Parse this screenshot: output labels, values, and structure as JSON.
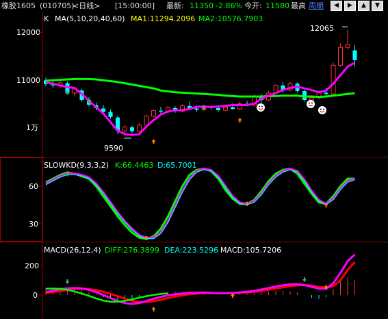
{
  "header": {
    "symbol": "橡胶1605",
    "code": "(010705)",
    "period": "<日线>",
    "time": "[15:00:00]",
    "latest_label": "最新:",
    "latest_value": "11350",
    "change_pct": "-2.86%",
    "open_label": "今开:",
    "open_value": "11580",
    "high_label": "最高",
    "cycle_label": "周期",
    "nav_icons": [
      "arrow-left-icon",
      "arrow-right-icon",
      "arrow-up-icon",
      "arrow-down-icon"
    ],
    "nav_glyphs": [
      "◀",
      "▶",
      "▲",
      "▼"
    ]
  },
  "colors": {
    "up": "#ff3232",
    "down": "#00ffff",
    "ma1": "#ff00ff",
    "ma2": "#00ff00",
    "grid": "#9a0000",
    "k_line": "#00ffff",
    "d_line": "#ff0000",
    "diff": "#ff00ff",
    "dea": "#ff0000",
    "text_ma2": "#00ff00",
    "text_cyan": "#00ffff"
  },
  "main": {
    "label": "K",
    "indicator": "MA(5,10,20,40,60)",
    "ma1_text": "MA1:11294.2096",
    "ma2_text": "MA2:10576.7903",
    "y_ticks": [
      "12000",
      "11000",
      "1万"
    ],
    "high_annotation": "12065",
    "low_annotation": "9590"
  },
  "kd": {
    "indicator": "SLOWKD(9,3,3,2)",
    "k_text": "K:66.4463",
    "d_text": "D:65.7001",
    "y_ticks": [
      "60",
      "30"
    ]
  },
  "macd": {
    "indicator": "MACD(26,12,4)",
    "diff_text": "DIFF:276.3899",
    "dea_text": "DEA:223.5296",
    "macd_text": "MACD:105.7206",
    "y_ticks": [
      "200",
      "0"
    ]
  },
  "chart_data": [
    {
      "type": "candlestick",
      "title": "橡胶1605 (010705) 日线",
      "ylim": [
        9300,
        12500
      ],
      "ma_ma1": [
        10830,
        10800,
        10760,
        10720,
        10700,
        10560,
        10400,
        10250,
        10100,
        9900,
        9700,
        9620,
        9600,
        9620,
        9800,
        9950,
        10080,
        10150,
        10180,
        10180,
        10210,
        10260,
        10270,
        10250,
        10270,
        10280,
        10300,
        10300,
        10300,
        10330,
        10450,
        10520,
        10580,
        10650,
        10700,
        10730,
        10690,
        10650,
        10600,
        10640,
        10800,
        11000,
        11200,
        11294
      ],
      "ma_ma2": [
        10870,
        10880,
        10890,
        10900,
        10910,
        10910,
        10910,
        10900,
        10880,
        10860,
        10840,
        10810,
        10780,
        10750,
        10720,
        10690,
        10640,
        10620,
        10600,
        10590,
        10580,
        10570,
        10560,
        10550,
        10540,
        10520,
        10510,
        10500,
        10500,
        10500,
        10500,
        10510,
        10510,
        10520,
        10520,
        10520,
        10500,
        10500,
        10490,
        10500,
        10520,
        10540,
        10560,
        10577
      ],
      "ohlc": [
        [
          10880,
          10940,
          10740,
          10790
        ],
        [
          10790,
          10850,
          10690,
          10760
        ],
        [
          10760,
          10870,
          10690,
          10820
        ],
        [
          10810,
          10850,
          10550,
          10580
        ],
        [
          10580,
          10700,
          10500,
          10680
        ],
        [
          10640,
          10680,
          10380,
          10420
        ],
        [
          10420,
          10480,
          10270,
          10310
        ],
        [
          10300,
          10360,
          10180,
          10230
        ],
        [
          10220,
          10300,
          10100,
          10140
        ],
        [
          10140,
          10200,
          9980,
          10020
        ],
        [
          10010,
          10050,
          9620,
          9700
        ],
        [
          9700,
          9840,
          9590,
          9790
        ],
        [
          9780,
          9820,
          9640,
          9690
        ],
        [
          9690,
          9880,
          9660,
          9830
        ],
        [
          9830,
          10080,
          9810,
          10040
        ],
        [
          10040,
          10200,
          10010,
          10170
        ],
        [
          10170,
          10260,
          10100,
          10150
        ],
        [
          10150,
          10290,
          10110,
          10240
        ],
        [
          10230,
          10270,
          10120,
          10160
        ],
        [
          10160,
          10320,
          10130,
          10280
        ],
        [
          10280,
          10380,
          10200,
          10220
        ],
        [
          10220,
          10290,
          10140,
          10190
        ],
        [
          10190,
          10300,
          10160,
          10260
        ],
        [
          10260,
          10290,
          10190,
          10230
        ],
        [
          10230,
          10270,
          10140,
          10180
        ],
        [
          10180,
          10290,
          10160,
          10250
        ],
        [
          10250,
          10340,
          10190,
          10210
        ],
        [
          10210,
          10380,
          10180,
          10330
        ],
        [
          10330,
          10400,
          10270,
          10300
        ],
        [
          10300,
          10560,
          10280,
          10500
        ],
        [
          10500,
          10560,
          10350,
          10420
        ],
        [
          10420,
          10640,
          10400,
          10580
        ],
        [
          10580,
          10800,
          10560,
          10760
        ],
        [
          10760,
          10840,
          10600,
          10650
        ],
        [
          10650,
          10850,
          10620,
          10800
        ],
        [
          10800,
          10830,
          10600,
          10630
        ],
        [
          10630,
          10660,
          10380,
          10420
        ],
        [
          10420,
          10520,
          10350,
          10470
        ],
        [
          10470,
          10620,
          10440,
          10590
        ],
        [
          10590,
          10700,
          10500,
          10560
        ],
        [
          10560,
          11300,
          10530,
          11230
        ],
        [
          11230,
          11750,
          11200,
          11650
        ],
        [
          11650,
          12065,
          11600,
          11720
        ],
        [
          11580,
          11700,
          11200,
          11350
        ]
      ]
    },
    {
      "type": "line",
      "title": "SLOWKD(9,3,3,2)",
      "ylim": [
        15,
        85
      ],
      "series": [
        {
          "name": "K",
          "values": [
            63,
            66,
            69,
            71,
            70,
            68,
            66,
            60,
            52,
            44,
            36,
            29,
            23,
            19,
            18,
            20,
            26,
            36,
            48,
            60,
            69,
            73,
            74,
            72,
            66,
            57,
            50,
            46,
            46,
            49,
            56,
            64,
            70,
            73,
            74,
            70,
            62,
            54,
            47,
            46,
            52,
            60,
            66,
            66
          ]
        },
        {
          "name": "D",
          "values": [
            62,
            65,
            68,
            70,
            70,
            69,
            67,
            62,
            55,
            47,
            39,
            32,
            26,
            21,
            19,
            19,
            23,
            32,
            44,
            56,
            66,
            72,
            74,
            73,
            68,
            60,
            52,
            47,
            46,
            48,
            54,
            62,
            68,
            72,
            74,
            72,
            65,
            56,
            49,
            46,
            50,
            58,
            64,
            66
          ]
        }
      ]
    },
    {
      "type": "bar",
      "title": "MACD(26,12,4)",
      "ylim": [
        -60,
        280
      ],
      "series": [
        {
          "name": "DIFF",
          "values": [
            20,
            30,
            40,
            45,
            48,
            45,
            35,
            20,
            0,
            -20,
            -40,
            -55,
            -60,
            -55,
            -40,
            -25,
            -12,
            -2,
            5,
            10,
            14,
            16,
            17,
            15,
            12,
            12,
            14,
            18,
            22,
            28,
            38,
            48,
            58,
            66,
            72,
            74,
            68,
            56,
            44,
            42,
            80,
            150,
            230,
            276
          ]
        },
        {
          "name": "DEA",
          "values": [
            15,
            20,
            28,
            35,
            40,
            42,
            40,
            33,
            22,
            8,
            -8,
            -25,
            -40,
            -48,
            -48,
            -42,
            -32,
            -20,
            -10,
            -2,
            5,
            10,
            13,
            14,
            13,
            12,
            13,
            15,
            18,
            22,
            28,
            36,
            44,
            52,
            60,
            66,
            68,
            64,
            56,
            50,
            60,
            100,
            170,
            224
          ]
        },
        {
          "name": "MACD",
          "values": [
            50,
            48,
            45,
            42,
            36,
            30,
            20,
            5,
            -15,
            -25,
            -35,
            -38,
            -30,
            -18,
            -10,
            0,
            12,
            20,
            25,
            22,
            18,
            12,
            8,
            4,
            2,
            0,
            4,
            8,
            10,
            14,
            20,
            24,
            28,
            30,
            25,
            20,
            0,
            -20,
            -25,
            -15,
            40,
            95,
            120,
            106
          ]
        }
      ]
    }
  ]
}
